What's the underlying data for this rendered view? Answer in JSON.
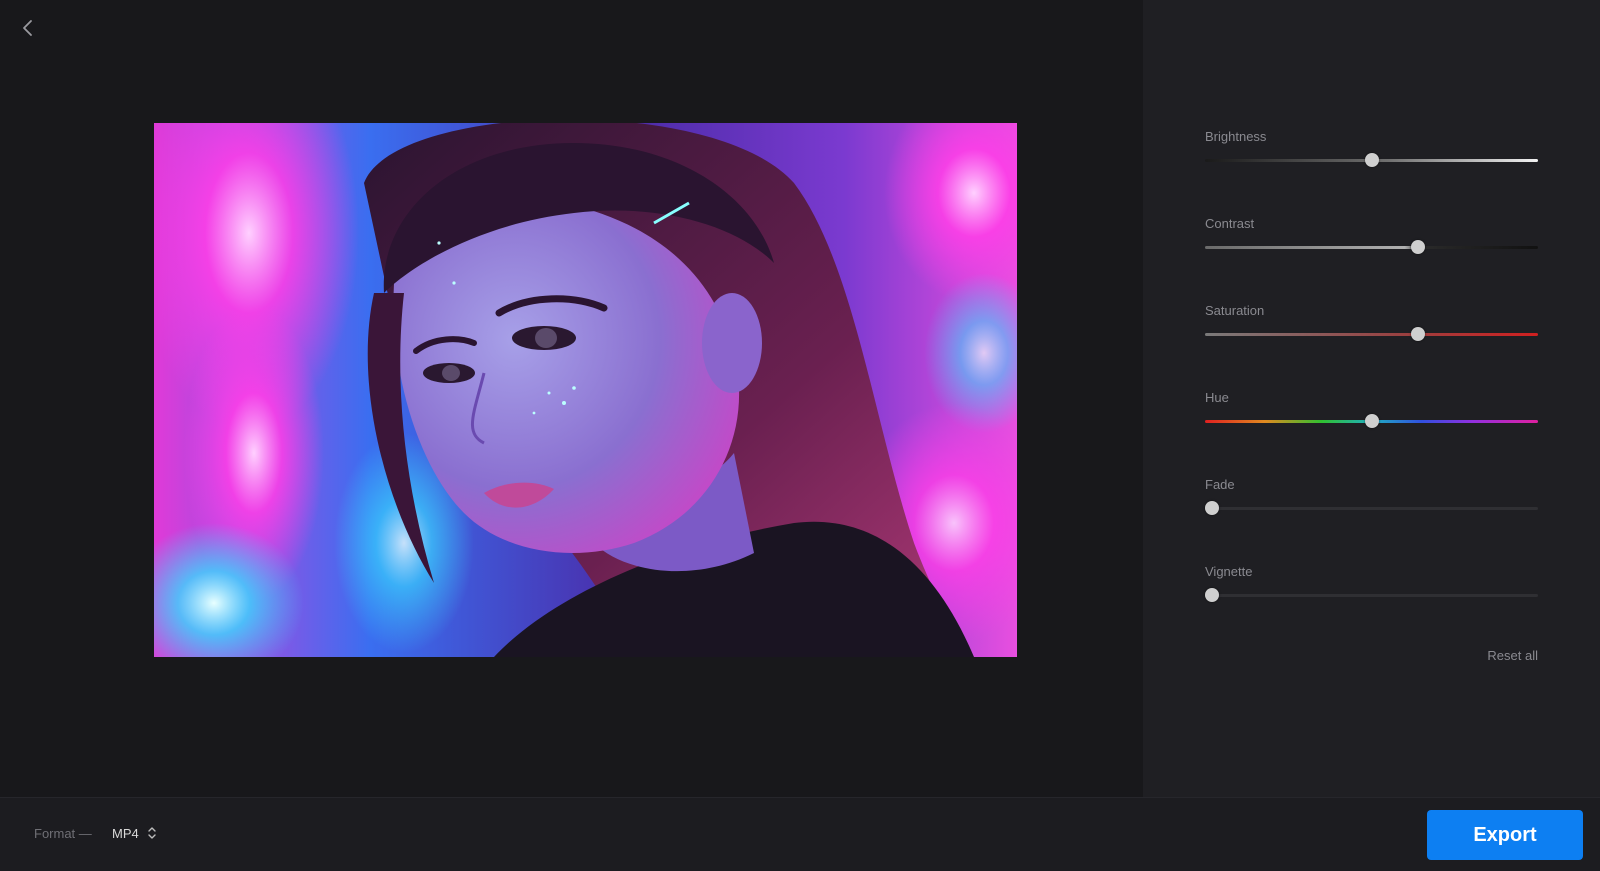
{
  "header": {
    "back_icon": "chevron-left-icon"
  },
  "preview": {
    "subject": "portrait-of-woman-neon-city"
  },
  "adjustments": {
    "brightness": {
      "label": "Brightness",
      "value": 0.5
    },
    "contrast": {
      "label": "Contrast",
      "value": 0.64
    },
    "saturation": {
      "label": "Saturation",
      "value": 0.64
    },
    "hue": {
      "label": "Hue",
      "value": 0.5
    },
    "fade": {
      "label": "Fade",
      "value": 0.02
    },
    "vignette": {
      "label": "Vignette",
      "value": 0.02
    },
    "reset_label": "Reset all"
  },
  "footer": {
    "format_label": "Format —",
    "format_value": "MP4",
    "export_label": "Export"
  },
  "colors": {
    "accent": "#0d7ff2",
    "background": "#18181b",
    "panel": "#1f1f23"
  }
}
